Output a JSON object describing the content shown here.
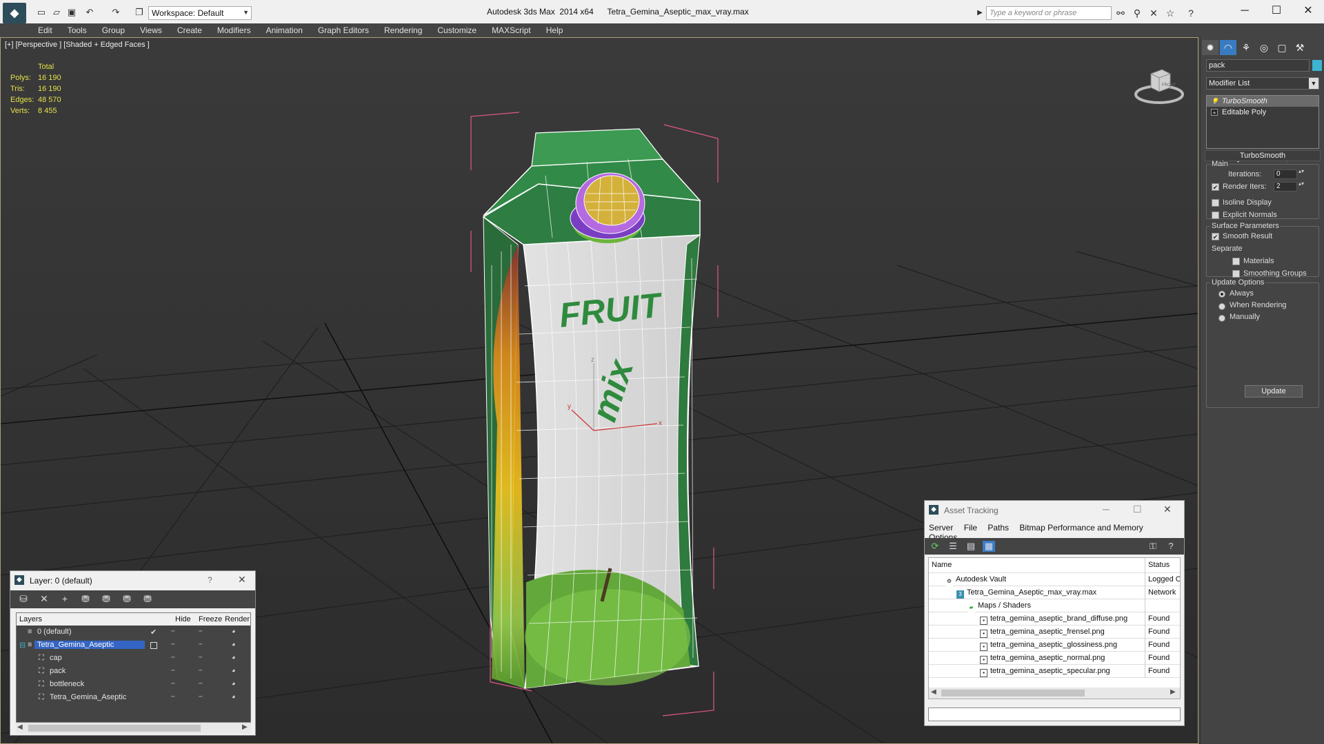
{
  "window": {
    "title": "Autodesk 3ds Max  2014 x64      Tetra_Gemina_Aseptic_max_vray.max",
    "workspace": "Workspace: Default",
    "search_placeholder": "Type a keyword or phrase"
  },
  "menu": [
    "Edit",
    "Tools",
    "Group",
    "Views",
    "Create",
    "Modifiers",
    "Animation",
    "Graph Editors",
    "Rendering",
    "Customize",
    "MAXScript",
    "Help"
  ],
  "viewport": {
    "label": "[+] [Perspective ] [Shaded + Edged Faces ]",
    "stats": {
      "header": "Total",
      "rows": [
        {
          "label": "Polys:",
          "value": "16 190"
        },
        {
          "label": "Tris:",
          "value": "16 190"
        },
        {
          "label": "Edges:",
          "value": "48 570"
        },
        {
          "label": "Verts:",
          "value": "8 455"
        }
      ]
    },
    "gizmo": {
      "x": "x",
      "y": "y",
      "z": "z"
    },
    "viewcube_label": "FRONT",
    "pack_text": {
      "brand1": "FRUIT",
      "brand2": "mix"
    }
  },
  "command_panel": {
    "object_name": "pack",
    "object_color": "#3cb4d2",
    "modifier_list": "Modifier List",
    "stack": [
      {
        "label": "TurboSmooth",
        "selected": true
      },
      {
        "label": "Editable Poly",
        "selected": false
      }
    ],
    "turbosmooth": {
      "title": "TurboSmooth",
      "main": "Main",
      "iterations_label": "Iterations:",
      "iterations": "0",
      "render_iters_label": "Render Iters:",
      "render_iters": "2",
      "isoline": "Isoline Display",
      "explicit_normals": "Explicit Normals",
      "surface_params": "Surface Parameters",
      "smooth_result": "Smooth Result",
      "separate": "Separate",
      "materials": "Materials",
      "smoothing_groups": "Smoothing Groups",
      "update_options": "Update Options",
      "always": "Always",
      "when_rendering": "When Rendering",
      "manually": "Manually",
      "update": "Update"
    }
  },
  "layer_dialog": {
    "title": "Layer: 0 (default)",
    "help": "?",
    "columns": {
      "layers": "Layers",
      "hide": "Hide",
      "freeze": "Freeze",
      "render": "Render"
    },
    "rows": [
      {
        "name": "0 (default)"
      },
      {
        "name": "Tetra_Gemina_Aseptic"
      },
      {
        "name": "cap"
      },
      {
        "name": "pack"
      },
      {
        "name": "bottleneck"
      },
      {
        "name": "Tetra_Gemina_Aseptic"
      }
    ]
  },
  "asset_dialog": {
    "title": "Asset Tracking",
    "menu": [
      "Server",
      "File",
      "Paths",
      "Bitmap Performance and Memory",
      "Options"
    ],
    "columns": {
      "name": "Name",
      "status": "Status"
    },
    "rows": [
      {
        "name": "Autodesk Vault",
        "status": "Logged Out"
      },
      {
        "name": "Tetra_Gemina_Aseptic_max_vray.max",
        "status": "Network"
      },
      {
        "name": "Maps / Shaders",
        "status": ""
      },
      {
        "name": "tetra_gemina_aseptic_brand_diffuse.png",
        "status": "Found"
      },
      {
        "name": "tetra_gemina_aseptic_frensel.png",
        "status": "Found"
      },
      {
        "name": "tetra_gemina_aseptic_glossiness.png",
        "status": "Found"
      },
      {
        "name": "tetra_gemina_aseptic_normal.png",
        "status": "Found"
      },
      {
        "name": "tetra_gemina_aseptic_specular.png",
        "status": "Found"
      }
    ]
  }
}
